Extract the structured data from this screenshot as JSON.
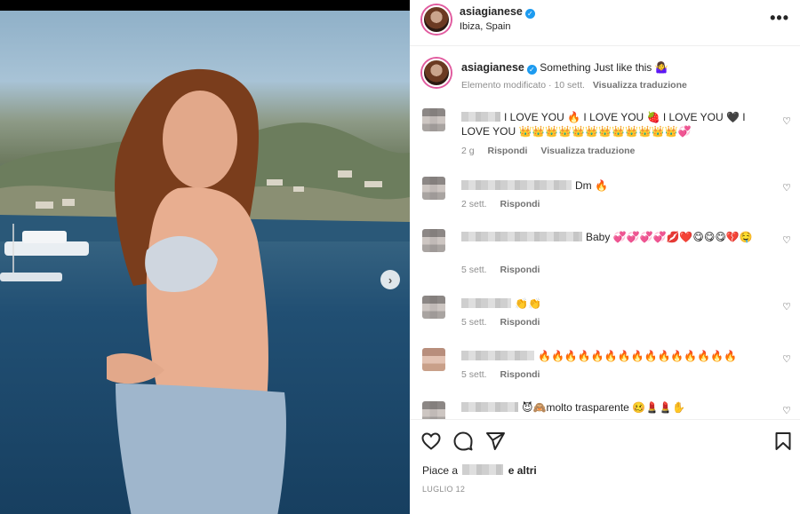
{
  "post": {
    "username": "asiagianese",
    "location": "Ibiza, Spain",
    "more_label": "•••"
  },
  "caption": {
    "username": "asiagianese",
    "text": "Something Just like this 🤷‍♀️",
    "edited": "Elemento modificato · 10 sett.",
    "translate": "Visualizza traduzione"
  },
  "comments": [
    {
      "text": "I LOVE YOU 🔥 I LOVE YOU 🍓 I LOVE YOU 🖤 I LOVE YOU 👑👑👑👑👑👑👑👑👑👑👑👑💞",
      "time": "2 g",
      "reply": "Rispondi",
      "translate": "Visualizza traduzione"
    },
    {
      "text": "Dm 🔥",
      "time": "2 sett.",
      "reply": "Rispondi"
    },
    {
      "text": "Baby 💞💞💞💞💋❤️😋😋😋💔🤤",
      "time": "5 sett.",
      "reply": "Rispondi"
    },
    {
      "text": "👏👏",
      "time": "5 sett.",
      "reply": "Rispondi"
    },
    {
      "text": "🔥🔥🔥🔥🔥🔥🔥🔥🔥🔥🔥🔥🔥🔥🔥",
      "time": "5 sett.",
      "reply": "Rispondi"
    },
    {
      "text": "😈🙈molto trasparente 🥴💄💄✋",
      "time": "",
      "reply": ""
    }
  ],
  "footer": {
    "likes_prefix": "Piace a",
    "likes_suffix": "e altri",
    "date": "LUGLIO 12"
  },
  "colors": {
    "verified": "#1d9bf0",
    "story_ring": "#e15b9f",
    "meta_text": "#8e8e8e"
  }
}
